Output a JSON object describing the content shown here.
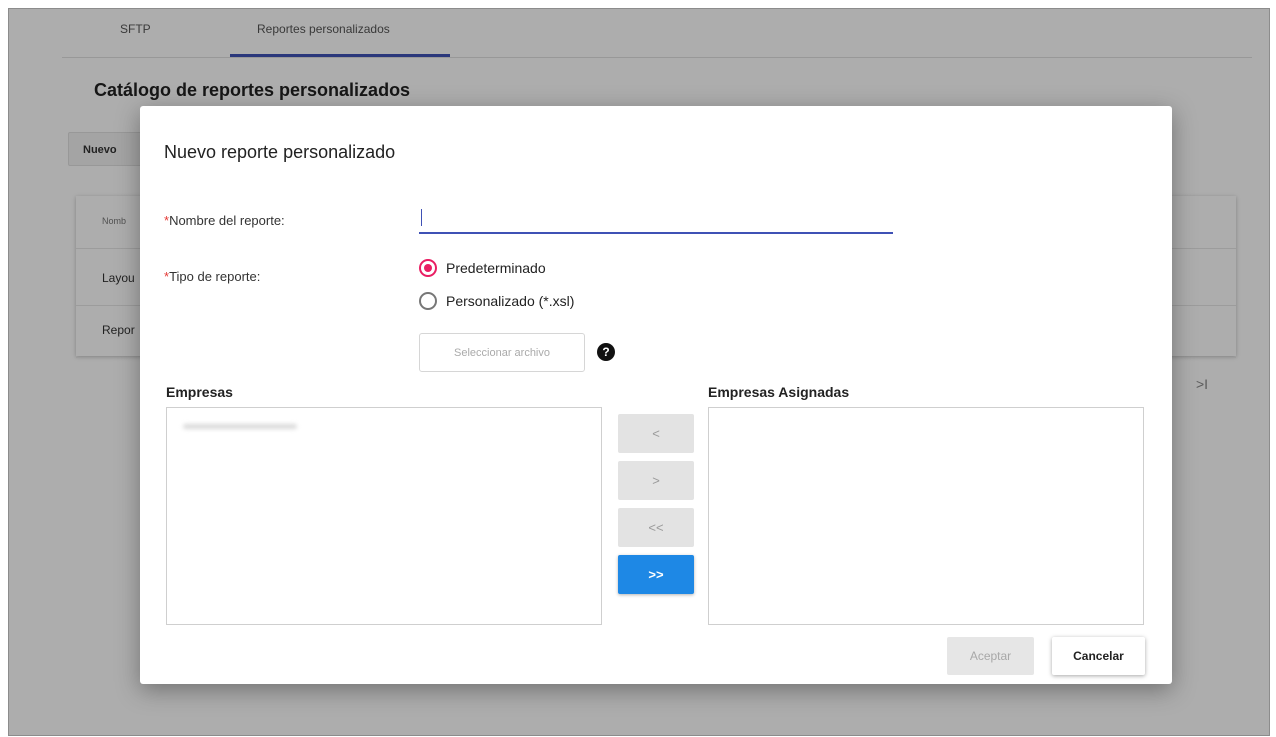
{
  "tabs": [
    {
      "label": "SFTP"
    },
    {
      "label": "Reportes personalizados"
    }
  ],
  "page": {
    "title": "Catálogo de reportes personalizados",
    "nuevo_label": "Nuevo",
    "table_rows": [
      "Nomb",
      "Layou",
      "Repor"
    ],
    "pager_last": ">I"
  },
  "dialog": {
    "title": "Nuevo reporte personalizado",
    "required_mark": "*",
    "name_label": "Nombre del reporte:",
    "name_value": "",
    "type_label": "Tipo de reporte:",
    "type_options": [
      {
        "label": "Predeterminado",
        "selected": true
      },
      {
        "label": "Personalizado (*.xsl)",
        "selected": false
      }
    ],
    "select_file_label": "Seleccionar archivo",
    "help_icon": "?",
    "empresas_title": "Empresas",
    "asignadas_title": "Empresas Asignadas",
    "move_buttons": [
      "<",
      ">",
      "<<",
      ">>"
    ],
    "accept_label": "Aceptar",
    "cancel_label": "Cancelar"
  },
  "colors": {
    "accent": "#3f51b5",
    "radio_selected": "#e91e63",
    "required_star": "#e53935",
    "primary_button": "#1e88e5"
  }
}
